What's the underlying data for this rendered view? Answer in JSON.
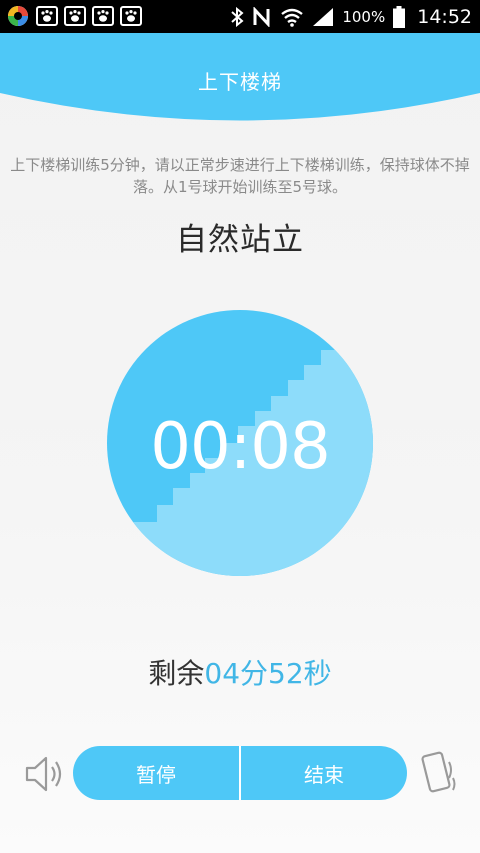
{
  "status_bar": {
    "battery_pct": "100%",
    "time": "14:52",
    "icons": [
      "app-icon",
      "baidu-icon",
      "baidu-icon",
      "baidu-icon",
      "baidu-icon",
      "bluetooth-icon",
      "nfc-icon",
      "wifi-icon",
      "signal-icon",
      "battery-icon"
    ]
  },
  "header": {
    "title": "上下楼梯",
    "color": "#4ec8f7"
  },
  "instructions": "上下楼梯训练5分钟，请以正常步速进行上下楼梯训练，保持球体不掉落。从1号球开始训练至5号球。",
  "stage_title": "自然站立",
  "timer": {
    "display": "00:08",
    "circle_color": "#4ec8f7",
    "stairs_color": "#8ddcfa"
  },
  "remaining": {
    "label": "剩余",
    "value": "04分52秒"
  },
  "controls": {
    "pause_label": "暂停",
    "end_label": "结束",
    "left_icon": "speaker-icon",
    "right_icon": "phone-vibrate-icon"
  }
}
